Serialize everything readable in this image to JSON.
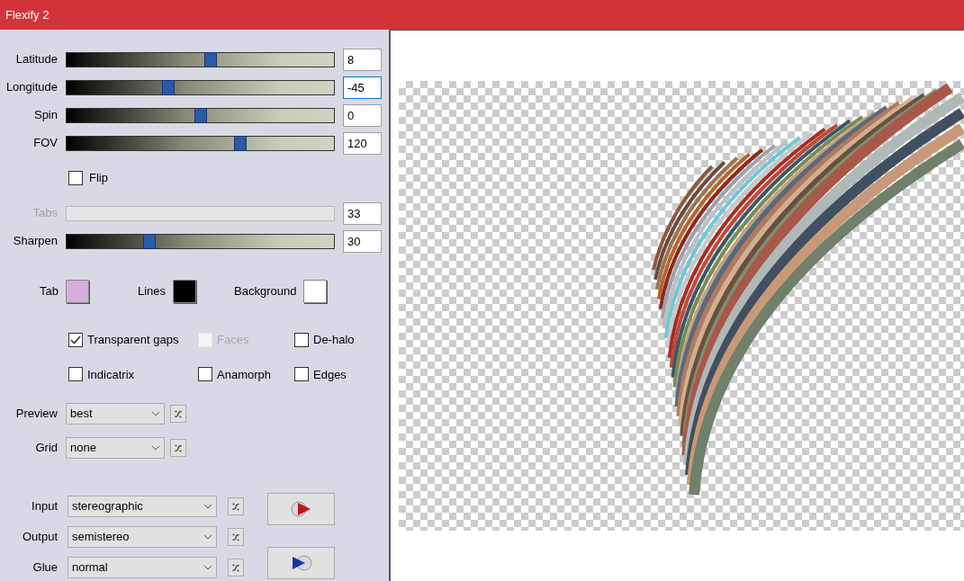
{
  "window": {
    "title": "Flexify 2"
  },
  "sliders": [
    {
      "label": "Latitude",
      "value": "8",
      "level": 0.54,
      "disabled": false,
      "focused": false
    },
    {
      "label": "Longitude",
      "value": "-45",
      "level": 0.38,
      "disabled": false,
      "focused": true
    },
    {
      "label": "Spin",
      "value": "0",
      "level": 0.5,
      "disabled": false,
      "focused": false
    },
    {
      "label": "FOV",
      "value": "120",
      "level": 0.65,
      "disabled": false,
      "focused": false
    },
    {
      "kind": "checkbox",
      "label": "Flip",
      "checked": false
    },
    {
      "label": "Tabs",
      "value": "33",
      "disabled": true,
      "focused": false
    },
    {
      "label": "Sharpen",
      "value": "30",
      "level": 0.31,
      "disabled": false,
      "focused": false
    }
  ],
  "colors": [
    {
      "label": "Tab",
      "color": "#d8acdc"
    },
    {
      "label": "Lines",
      "color": "#000000"
    },
    {
      "label": "Background",
      "color": "#ffffff"
    }
  ],
  "options": [
    {
      "label": "Transparent gaps",
      "checked": true,
      "disabled": false
    },
    {
      "label": "Faces",
      "checked": false,
      "disabled": true
    },
    {
      "label": "De-halo",
      "checked": false,
      "disabled": false
    },
    {
      "label": "Indicatrix",
      "checked": false,
      "disabled": false
    },
    {
      "label": "Anamorph",
      "checked": false,
      "disabled": false
    },
    {
      "label": "Edges",
      "checked": false,
      "disabled": false
    }
  ],
  "view_selects": [
    {
      "label": "Preview",
      "value": "best"
    },
    {
      "label": "Grid",
      "value": "none"
    }
  ],
  "mapping_selects": [
    {
      "label": "Input",
      "value": "stereographic"
    },
    {
      "label": "Output",
      "value": "semistereo"
    },
    {
      "label": "Glue",
      "value": "normal"
    }
  ]
}
